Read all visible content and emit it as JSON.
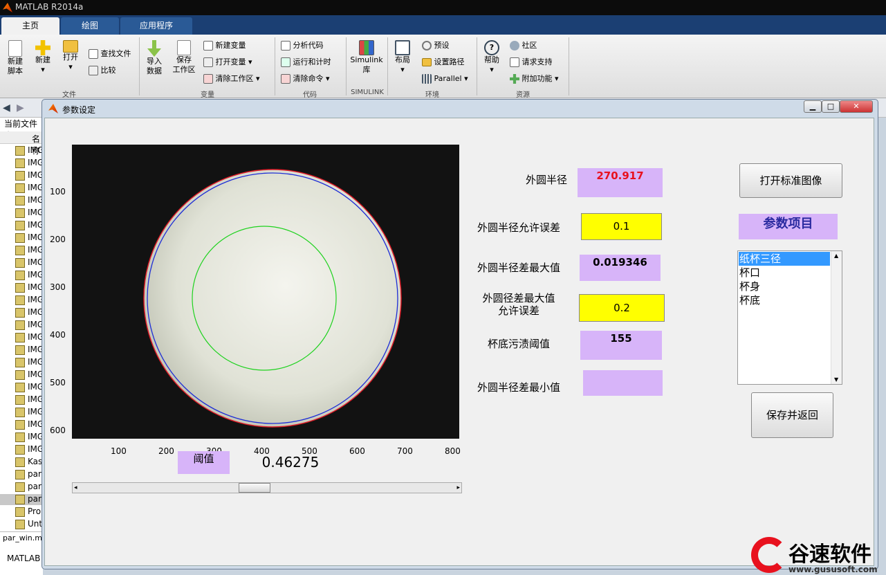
{
  "app": {
    "title": "MATLAB R2014a"
  },
  "ribbon": {
    "tabs": [
      "主页",
      "绘图",
      "应用程序"
    ],
    "buttons": {
      "new_script": "新建\n脚本",
      "new": "新建",
      "open": "打开",
      "find_files": "查找文件",
      "compare": "比较",
      "import_data": "导入\n数据",
      "save_workspace": "保存\n工作区",
      "new_variable": "新建变量",
      "open_variable": "打开变量",
      "clear_workspace": "清除工作区",
      "analyze_code": "分析代码",
      "run_and_time": "运行和计时",
      "clear_commands": "清除命令",
      "simulink_library": "Simulink\n库",
      "layout": "布局",
      "preferences": "预设",
      "set_path": "设置路径",
      "parallel": "Parallel",
      "help": "帮助",
      "community": "社区",
      "request_support": "请求支持",
      "add_ons": "附加功能"
    },
    "groups": [
      "文件",
      "变量",
      "代码",
      "SIMULINK",
      "环境",
      "资源"
    ]
  },
  "sidebar": {
    "current_folder": "当前文件夹",
    "name_header": "名称",
    "files": [
      "IMG",
      "IMG",
      "IMG",
      "IMG",
      "IMG",
      "IMG",
      "IMG",
      "IMG",
      "IMG",
      "IMG",
      "IMG",
      "IMG",
      "IMG",
      "IMG",
      "IMG",
      "IMG",
      "IMG",
      "IMG",
      "IMG",
      "IMG",
      "IMG",
      "IMG",
      "IMG",
      "IMG",
      "IMG",
      "Kas",
      "par",
      "par",
      "par",
      "Pro",
      "Unt"
    ],
    "bottom_file": "par_win.m",
    "command_window": "MATLAB"
  },
  "dialog": {
    "title": "参数设定",
    "labels": {
      "outer_radius": "外圆半径",
      "outer_radius_tol": "外圆半径允许误差",
      "outer_radius_diff_max": "外圆半径差最大值",
      "outer_dia_diff_tol_line1": "外圆径差最大值",
      "outer_dia_diff_tol_line2": "允许误差",
      "bottom_stain_threshold": "杯底污渍阈值",
      "outer_radius_diff_min": "外圆半径差最小值",
      "threshold": "阈值"
    },
    "values": {
      "outer_radius": "270.917",
      "outer_radius_tol": "0.1",
      "outer_radius_diff_max": "0.019346",
      "outer_dia_diff_tol": "0.2",
      "bottom_stain_threshold": "155",
      "outer_radius_diff_min": "",
      "threshold": "0.46275"
    },
    "buttons": {
      "open_standard_image": "打开标准图像",
      "save_and_return": "保存并返回"
    },
    "param_header": "参数项目",
    "param_list": [
      "纸杯三径",
      "杯口",
      "杯身",
      "杯底"
    ],
    "slider_value": 0.46275
  },
  "axes": {
    "x_ticks": [
      "100",
      "200",
      "300",
      "400",
      "500",
      "600",
      "700",
      "800"
    ],
    "y_ticks": [
      "100",
      "200",
      "300",
      "400",
      "500",
      "600"
    ]
  },
  "watermark": {
    "text": "谷速软件",
    "url": "www.gususoft.com"
  },
  "colors": {
    "accent_red": "#e8111e",
    "yellow_box": "#ffff00",
    "purple_box": "#d7b4f9"
  }
}
